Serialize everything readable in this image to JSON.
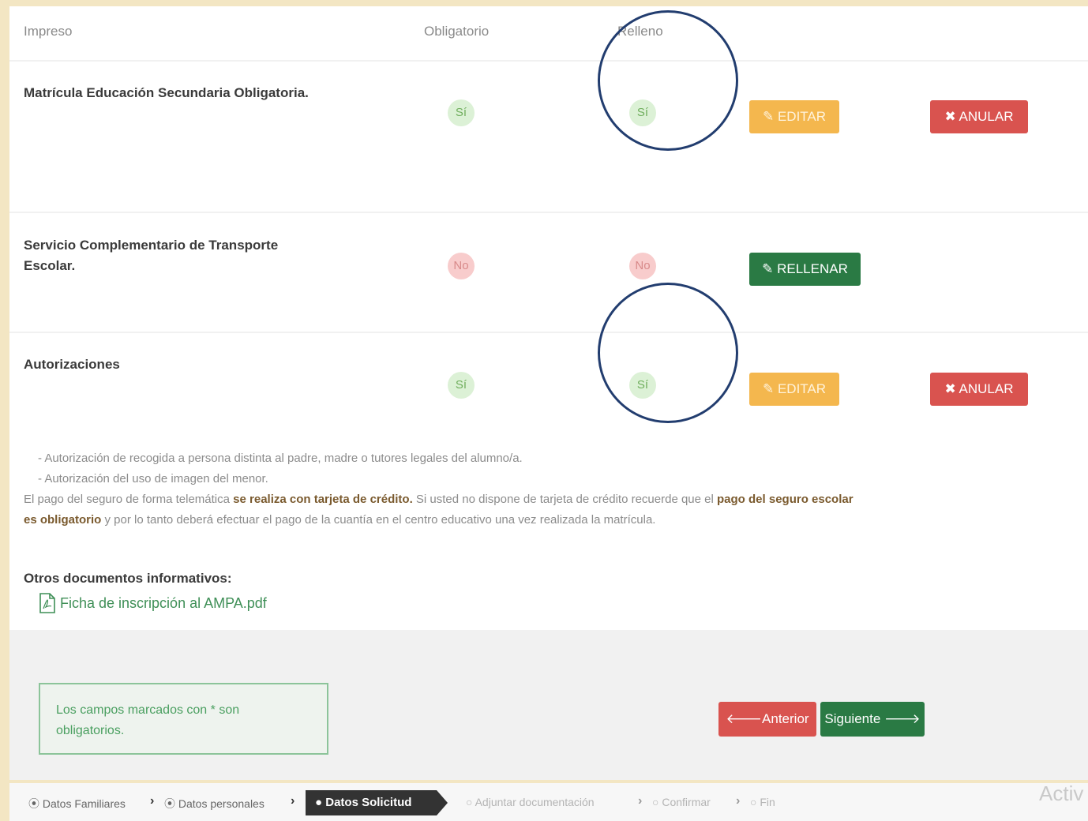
{
  "table": {
    "headers": {
      "impreso": "Impreso",
      "obligatorio": "Obligatorio",
      "relleno": "Relleno"
    },
    "rows": [
      {
        "title": "Matrícula Educación Secundaria Obligatoria.",
        "obligatorio": "Sí",
        "relleno": "Sí",
        "primary_action": "EDITAR",
        "secondary_action": "ANULAR"
      },
      {
        "title_line1": "Servicio Complementario de Transporte",
        "title_line2": "Escolar.",
        "obligatorio": "No",
        "relleno": "No",
        "primary_action": "RELLENAR"
      },
      {
        "title": "Autorizaciones",
        "obligatorio": "Sí",
        "relleno": "Sí",
        "primary_action": "EDITAR",
        "secondary_action": "ANULAR"
      }
    ]
  },
  "info": {
    "line1": "- Autorización de recogida a persona distinta al padre, madre o tutores legales del alumno/a.",
    "line2": "- Autorización del uso de imagen del menor.",
    "p_start": "El pago del seguro de forma telemática ",
    "p_bold1": "se realiza con tarjeta de crédito.",
    "p_mid": " Si usted no dispone de tarjeta de crédito recuerde que el ",
    "p_bold2a": "pago del seguro escolar",
    "p_bold2b": "es obligatorio",
    "p_end": " y por lo tanto deberá efectuar el pago de la cuantía en el centro educativo una vez realizada la matrícula."
  },
  "other_docs": {
    "heading": "Otros documentos informativos:",
    "file": "Ficha de inscripción al AMPA.pdf"
  },
  "notice": {
    "line1": "Los campos marcados con * son",
    "line2": "obligatorios."
  },
  "nav": {
    "prev": "Anterior",
    "next": "Siguiente"
  },
  "breadcrumb": {
    "s1": "Datos Familiares",
    "s2": "Datos personales",
    "s3": "Datos Solicitud",
    "s4": "Adjuntar documentación",
    "s5": "Confirmar",
    "s6": "Fin"
  },
  "watermark": "Activ",
  "colors": {
    "accent_green": "#2a7a44",
    "danger": "#d9534f",
    "warning": "#f4b74e",
    "annotation": "#223d6f"
  }
}
